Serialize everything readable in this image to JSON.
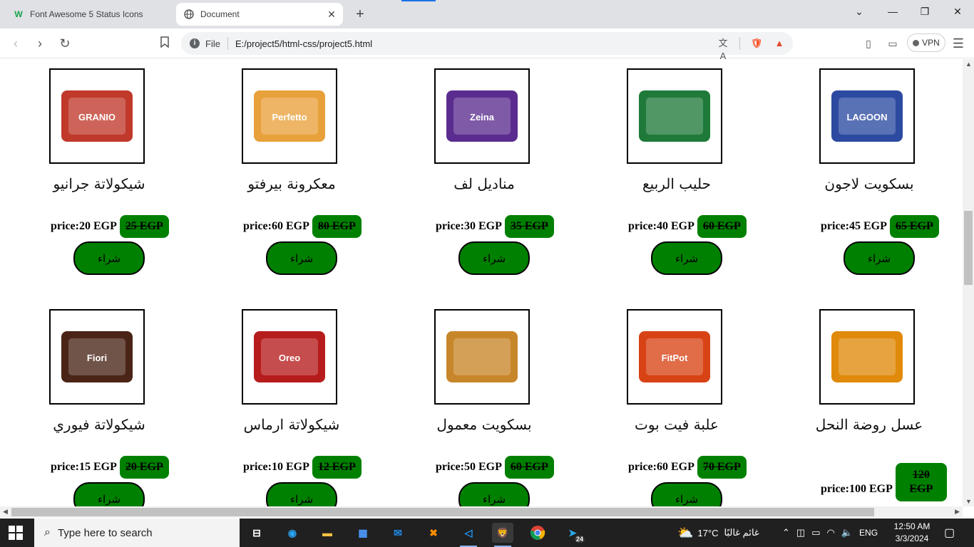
{
  "browser": {
    "tabs": [
      {
        "title": "Font Awesome 5 Status Icons",
        "icon": "w-favicon-icon"
      },
      {
        "title": "Document",
        "icon": "globe-icon"
      }
    ],
    "url_prefix": "File",
    "url": "E:/project5/html-css/project5.html",
    "vpn_label": "VPN"
  },
  "products": [
    {
      "name": "شيكولاتة جرانيو",
      "price": "price:20 EGP",
      "old_price": "25 EGP",
      "buy": "شراء",
      "img_color": "#c0392b",
      "img_label": "GRANIO"
    },
    {
      "name": "معكرونة بيرفتو",
      "price": "price:60 EGP",
      "old_price": "80 EGP",
      "buy": "شراء",
      "img_color": "#e8a13a",
      "img_label": "Perfetto"
    },
    {
      "name": "مناديل لف",
      "price": "price:30 EGP",
      "old_price": "35 EGP",
      "buy": "شراء",
      "img_color": "#5b2c8f",
      "img_label": "Zeina"
    },
    {
      "name": "حليب الربيع",
      "price": "price:40 EGP",
      "old_price": "60 EGP",
      "buy": "شراء",
      "img_color": "#1f7a3a",
      "img_label": ""
    },
    {
      "name": "بسكويت لاجون",
      "price": "price:45 EGP",
      "old_price": "65 EGP",
      "buy": "شراء",
      "img_color": "#2b4aa0",
      "img_label": "LAGOON"
    },
    {
      "name": "شيكولاتة فيوري",
      "price": "price:15 EGP",
      "old_price": "20 EGP",
      "buy": "شراء",
      "img_color": "#4a2416",
      "img_label": "Fiori"
    },
    {
      "name": "شيكولاتة ارماس",
      "price": "price:10 EGP",
      "old_price": "12 EGP",
      "buy": "شراء",
      "img_color": "#b71c1c",
      "img_label": "Oreo"
    },
    {
      "name": "بسكويت معمول",
      "price": "price:50 EGP",
      "old_price": "60 EGP",
      "buy": "شراء",
      "img_color": "#c8862a",
      "img_label": ""
    },
    {
      "name": "علبة فيت بوت",
      "price": "price:60 EGP",
      "old_price": "70 EGP",
      "buy": "شراء",
      "img_color": "#d84315",
      "img_label": "FitPot"
    },
    {
      "name": "عسل روضة النحل",
      "price": "price:100 EGP",
      "old_price": "120 EGP",
      "buy": "",
      "img_color": "#e08a0b",
      "img_label": ""
    }
  ],
  "taskbar": {
    "search_placeholder": "Type here to search",
    "weather_temp": "17°C",
    "weather_text": "غائم غالبًا",
    "lang": "ENG",
    "time": "12:50 AM",
    "date": "3/3/2024",
    "notification_count": "24"
  }
}
